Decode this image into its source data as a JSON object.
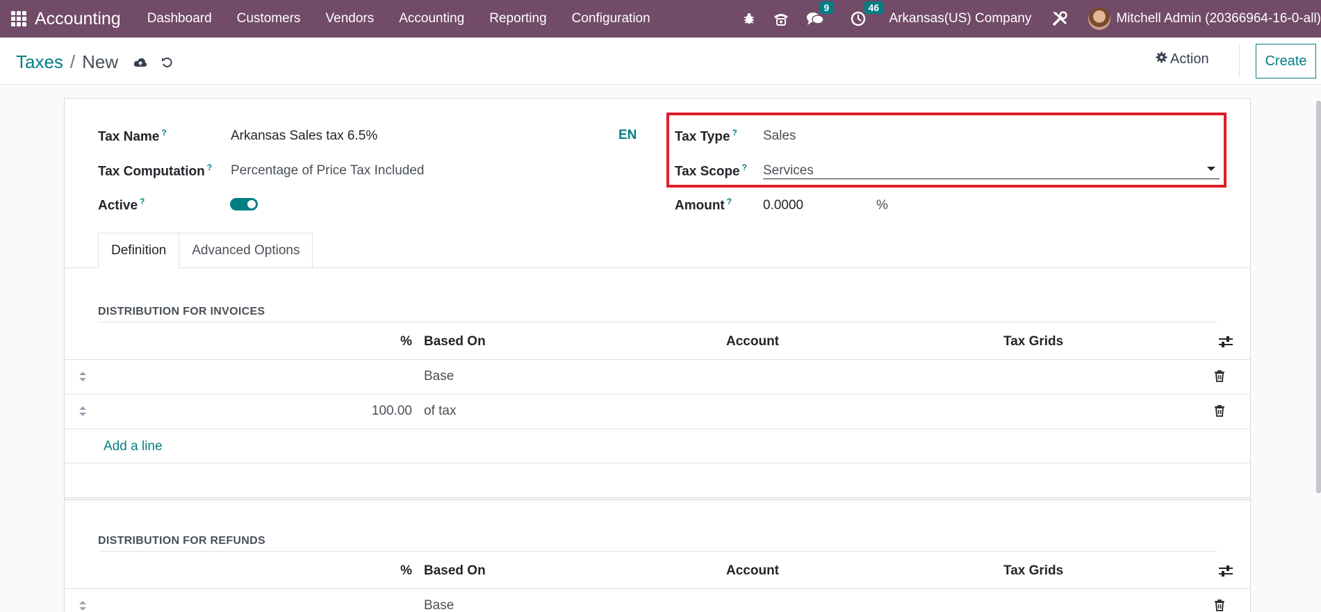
{
  "navbar": {
    "app_name": "Accounting",
    "menu": [
      "Dashboard",
      "Customers",
      "Vendors",
      "Accounting",
      "Reporting",
      "Configuration"
    ],
    "messages_badge": "9",
    "activities_badge": "46",
    "company": "Arkansas(US) Company",
    "user": "Mitchell Admin (20366964-16-0-all)"
  },
  "control": {
    "breadcrumb_parent": "Taxes",
    "breadcrumb_separator": "/",
    "breadcrumb_current": "New",
    "action_label": "Action",
    "create_label": "Create"
  },
  "form": {
    "tax_name_label": "Tax Name",
    "tax_name_value": "Arkansas Sales tax 6.5%",
    "lang": "EN",
    "tax_computation_label": "Tax Computation",
    "tax_computation_value": "Percentage of Price Tax Included",
    "active_label": "Active",
    "active_value": true,
    "tax_type_label": "Tax Type",
    "tax_type_value": "Sales",
    "tax_scope_label": "Tax Scope",
    "tax_scope_value": "Services",
    "amount_label": "Amount",
    "amount_value": "0.0000",
    "amount_unit": "%",
    "help_mark": "?"
  },
  "tabs": [
    "Definition",
    "Advanced Options"
  ],
  "invoices": {
    "title": "DISTRIBUTION FOR INVOICES",
    "columns": [
      "%",
      "Based On",
      "Account",
      "Tax Grids"
    ],
    "rows": [
      {
        "percent": "",
        "based_on": "Base",
        "account": "",
        "tax_grids": ""
      },
      {
        "percent": "100.00",
        "based_on": "of tax",
        "account": "",
        "tax_grids": ""
      }
    ],
    "add_line": "Add a line"
  },
  "refunds": {
    "title": "DISTRIBUTION FOR REFUNDS",
    "columns": [
      "%",
      "Based On",
      "Account",
      "Tax Grids"
    ],
    "rows": [
      {
        "percent": "",
        "based_on": "Base",
        "account": "",
        "tax_grids": ""
      }
    ]
  },
  "colors": {
    "navbar": "#714b67",
    "accent": "#017e84",
    "highlight": "#e11d2a"
  }
}
